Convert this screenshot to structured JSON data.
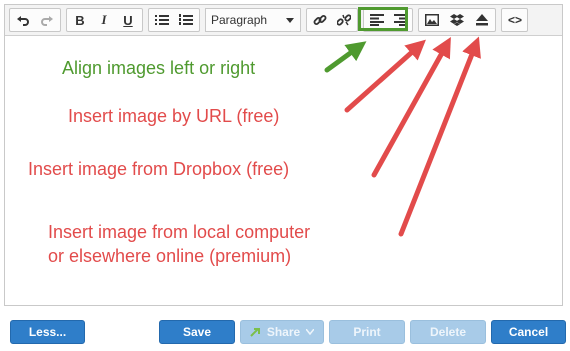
{
  "toolbar": {
    "paragraph_label": "Paragraph",
    "icons": [
      "undo-icon",
      "redo-icon",
      "bold-icon",
      "italic-icon",
      "underline-icon",
      "bullet-list-icon",
      "numbered-list-icon",
      "link-icon",
      "unlink-icon",
      "align-left-icon",
      "align-right-icon",
      "image-icon",
      "dropbox-icon",
      "upload-icon",
      "code-icon"
    ]
  },
  "annotations": {
    "align": "Align images left or right",
    "url": "Insert image by URL (free)",
    "dropbox": "Insert image from Dropbox (free)",
    "local_line1": "Insert image from local computer",
    "local_line2": "or elsewhere online (premium)"
  },
  "colors": {
    "green": "#4f9a2f",
    "red": "#e24b4b",
    "blue": "#2f7ec9"
  },
  "footer": {
    "less": "Less...",
    "save": "Save",
    "share": "Share",
    "print": "Print",
    "delete": "Delete",
    "cancel": "Cancel"
  }
}
